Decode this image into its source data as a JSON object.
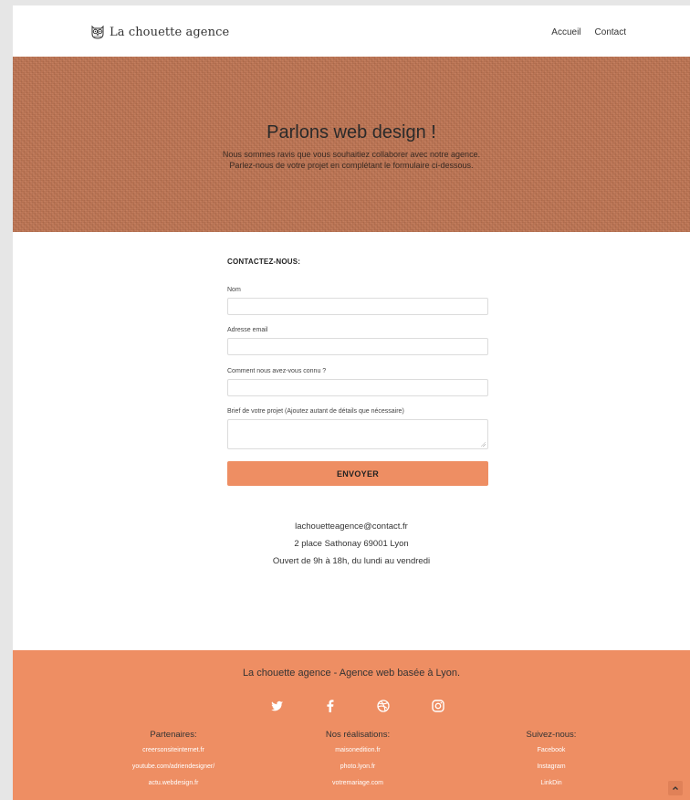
{
  "header": {
    "logo_text": "La chouette agence",
    "nav": [
      {
        "label": "Accueil"
      },
      {
        "label": "Contact"
      }
    ]
  },
  "hero": {
    "title": "Parlons web design !",
    "subtitle_line1": "Nous sommes ravis que vous souhaitiez collaborer avec notre agence.",
    "subtitle_line2": "Parlez-nous de votre projet en complétant le formulaire ci-dessous."
  },
  "form": {
    "title": "CONTACTEZ-NOUS:",
    "fields": [
      {
        "label": "Nom",
        "value": ""
      },
      {
        "label": "Adresse email",
        "value": ""
      },
      {
        "label": "Comment nous avez-vous connu ?",
        "value": ""
      },
      {
        "label": "Brief de votre projet (Ajoutez autant de détails que nécessaire)",
        "value": ""
      }
    ],
    "submit_label": "ENVOYER"
  },
  "contact": {
    "email": "lachouetteagence@contact.fr",
    "address": "2 place Sathonay 69001 Lyon",
    "hours": "Ouvert de 9h à 18h, du lundi au vendredi"
  },
  "footer": {
    "title": "La chouette agence - Agence web basée à Lyon.",
    "socials": [
      "twitter-icon",
      "facebook-icon",
      "dribbble-icon",
      "instagram-icon"
    ],
    "columns": [
      {
        "title": "Partenaires:",
        "links": [
          "creersonsiteinternet.fr",
          "youtube.com/adriendesigner/",
          "actu.webdesign.fr"
        ]
      },
      {
        "title": "Nos réalisations:",
        "links": [
          "maisonedition.fr",
          "photo.lyon.fr",
          "votremariage.com"
        ]
      },
      {
        "title": "Suivez-nous:",
        "links": [
          "Facebook",
          "Instagram",
          "LinkDin"
        ]
      }
    ]
  },
  "colors": {
    "hero": "#c07654",
    "accent": "#ee8e63",
    "page_bg": "#e6e6e6"
  }
}
